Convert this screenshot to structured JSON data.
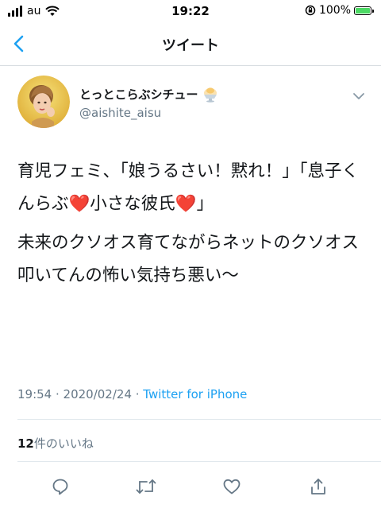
{
  "status_bar": {
    "carrier": "au",
    "time": "19:22",
    "battery_percent": "100%",
    "battery_level": 1.0
  },
  "nav": {
    "title": "ツイート"
  },
  "tweet": {
    "display_name": "とっとこらぶシチュー",
    "handle": "@aishite_aisu",
    "text_1_pre": "育児フェミ、「娘うるさい！黙れ！」「息子くんらぶ",
    "text_1_mid": "小さな彼氏",
    "text_1_end": "」",
    "text_2": "未来のクソオス育てながらネットのクソオス叩いてんの怖い気持ち悪い〜",
    "heart_emoji": "❤️",
    "timestamp": "19:54 · 2020/02/24 · ",
    "source": "Twitter for iPhone",
    "likes_count": "12",
    "likes_label": "件のいいね"
  },
  "colors": {
    "link": "#1da1f2",
    "muted": "#657786",
    "text": "#14171a",
    "heart": "#e0245e"
  },
  "icons": [
    "back-chevron",
    "reply-icon",
    "retweet-icon",
    "like-icon",
    "share-icon",
    "caret-down-icon"
  ]
}
